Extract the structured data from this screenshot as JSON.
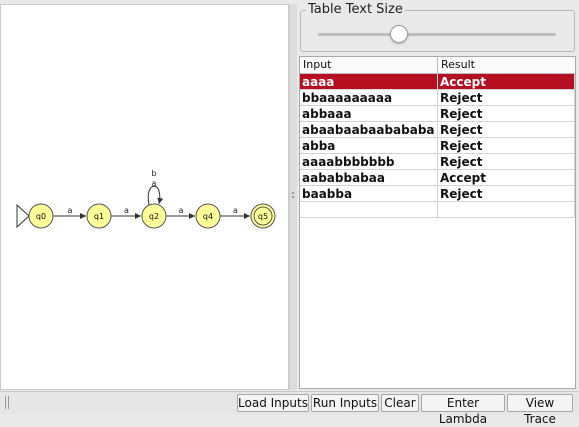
{
  "diagram": {
    "states": [
      {
        "id": "q0",
        "label": "q0",
        "initial": true,
        "final": false
      },
      {
        "id": "q1",
        "label": "q1",
        "initial": false,
        "final": false
      },
      {
        "id": "q2",
        "label": "q2",
        "initial": false,
        "final": false
      },
      {
        "id": "q4",
        "label": "q4",
        "initial": false,
        "final": false
      },
      {
        "id": "q5",
        "label": "q5",
        "initial": false,
        "final": true
      }
    ],
    "transitions": [
      {
        "from": "q0",
        "to": "q1",
        "label": "a"
      },
      {
        "from": "q1",
        "to": "q2",
        "label": "a"
      },
      {
        "from": "q2",
        "to": "q4",
        "label": "a"
      },
      {
        "from": "q4",
        "to": "q5",
        "label": "a"
      }
    ],
    "self_loop": {
      "state": "q2",
      "labels": [
        "b",
        "a"
      ]
    },
    "state_fill": "#ffff99",
    "state_stroke": "#555555"
  },
  "text_size": {
    "title": "Table Text Size",
    "slider_value": 0.34
  },
  "table": {
    "columns": [
      "Input",
      "Result"
    ],
    "rows": [
      {
        "input": "aaaa",
        "result": "Accept",
        "selected": true
      },
      {
        "input": "bbaaaaaaaaa",
        "result": "Reject",
        "selected": false
      },
      {
        "input": "abbaaa",
        "result": "Reject",
        "selected": false
      },
      {
        "input": "abaabaabaabababa",
        "result": "Reject",
        "selected": false
      },
      {
        "input": "abba",
        "result": "Reject",
        "selected": false
      },
      {
        "input": "aaaabbbbbbb",
        "result": "Reject",
        "selected": false
      },
      {
        "input": "aababbabaa",
        "result": "Accept",
        "selected": false
      },
      {
        "input": "baabba",
        "result": "Reject",
        "selected": false
      },
      {
        "input": "",
        "result": "",
        "selected": false
      }
    ],
    "selection_color": "#b50f22"
  },
  "toolbar": {
    "load": "Load Inputs",
    "run": "Run Inputs",
    "clear": "Clear",
    "lambda": "Enter Lambda",
    "trace": "View Trace"
  }
}
